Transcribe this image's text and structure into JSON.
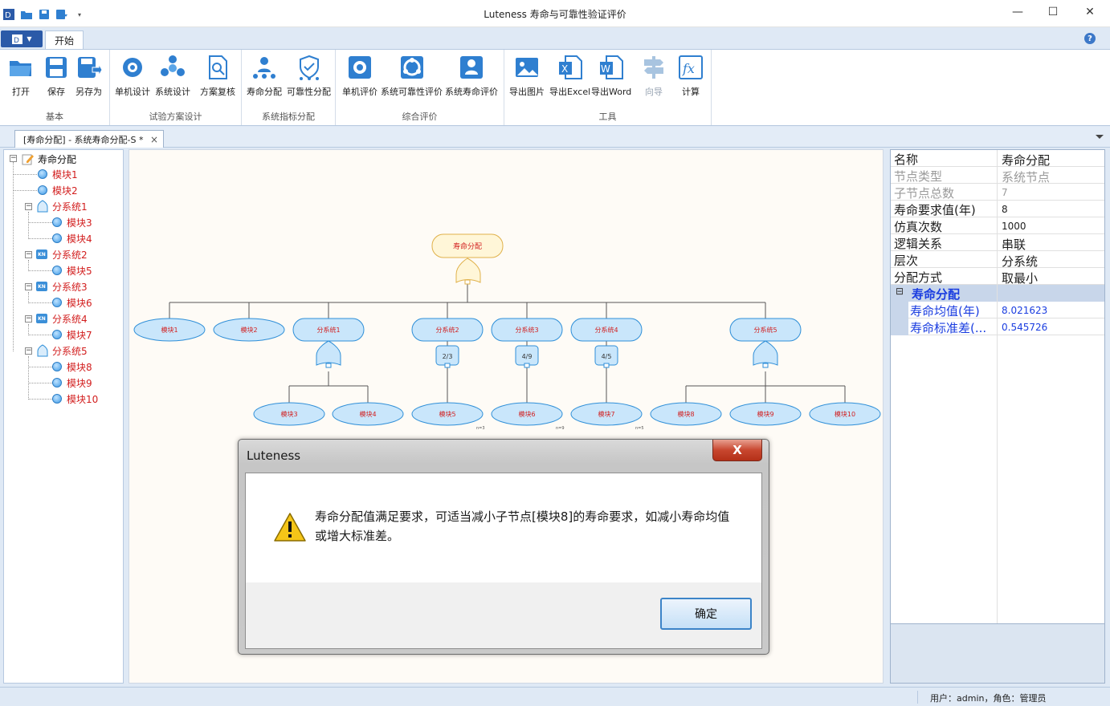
{
  "window": {
    "title": "Luteness 寿命与可靠性验证评价"
  },
  "ribbon": {
    "app_button_label": "",
    "tab_start": "开始",
    "groups": {
      "basic": {
        "label": "基本",
        "open": "打开",
        "save": "保存",
        "save_as": "另存为"
      },
      "test_plan": {
        "label": "试验方案设计",
        "unit_design": "单机设计",
        "system_design": "系统设计",
        "plan_review": "方案复核"
      },
      "allocation": {
        "label": "系统指标分配",
        "life_alloc": "寿命分配",
        "rel_alloc": "可靠性分配"
      },
      "evaluation": {
        "label": "综合评价",
        "unit_eval": "单机评价",
        "sys_rel_eval": "系统可靠性评价",
        "sys_life_eval": "系统寿命评价"
      },
      "tools": {
        "label": "工具",
        "export_image": "导出图片",
        "export_excel": "导出Excel",
        "export_word": "导出Word",
        "wizard": "向导",
        "calculate": "计算"
      }
    }
  },
  "doc_tab": {
    "label": "[寿命分配] - 系统寿命分配-S *",
    "close": "×"
  },
  "tree": {
    "root": "寿命分配",
    "module1": "模块1",
    "module2": "模块2",
    "sub1": "分系统1",
    "module3": "模块3",
    "module4": "模块4",
    "sub2": "分系统2",
    "module5": "模块5",
    "sub3": "分系统3",
    "module6": "模块6",
    "sub4": "分系统4",
    "module7": "模块7",
    "sub5": "分系统5",
    "module8": "模块8",
    "module9": "模块9",
    "module10": "模块10"
  },
  "diagram": {
    "root": "寿命分配",
    "nodes": {
      "m1": "模块1",
      "m2": "模块2",
      "s1": "分系统1",
      "s2": "分系统2",
      "s3": "分系统3",
      "s4": "分系统4",
      "s5": "分系统5",
      "m3": "模块3",
      "m4": "模块4",
      "m5": "模块5",
      "m6": "模块6",
      "m7": "模块7",
      "m8": "模块8",
      "m9": "模块9",
      "m10": "模块10"
    },
    "kn_labels": {
      "s2": "2/3",
      "s3": "4/9",
      "s4": "4/5"
    },
    "n_labels": {
      "m5": "n=3",
      "m6": "n=9",
      "m7": "n=5"
    }
  },
  "properties": {
    "rows": [
      {
        "key": "名称",
        "value": "寿命分配"
      },
      {
        "key": "节点类型",
        "value": "系统节点"
      },
      {
        "key": "子节点总数",
        "value": "7"
      },
      {
        "key": "寿命要求值(年)",
        "value": "8"
      },
      {
        "key": "仿真次数",
        "value": "1000"
      },
      {
        "key": "逻辑关系",
        "value": "串联"
      },
      {
        "key": "层次",
        "value": "分系统"
      },
      {
        "key": "分配方式",
        "value": "取最小"
      }
    ],
    "category": {
      "expander": "⊟",
      "label": "寿命分配"
    },
    "sub_rows": [
      {
        "key": "寿命均值(年)",
        "value": "8.021623"
      },
      {
        "key": "寿命标准差(...",
        "value": "0.545726"
      }
    ]
  },
  "status": {
    "text": "用户：admin，角色：管理员"
  },
  "dialog": {
    "title": "Luteness",
    "close_label": "X",
    "message": "寿命分配值满足要求，可适当减小子节点[模块8]的寿命要求，如减小寿命均值或增大标准差。",
    "ok_label": "确定"
  },
  "colors": {
    "accent": "#2b5aa8",
    "node_fill": "#c9e6fb",
    "node_stroke": "#2f8fd8",
    "node_text": "#d21e1e",
    "root_fill": "#fff6d8",
    "root_stroke": "#e0b14a"
  }
}
